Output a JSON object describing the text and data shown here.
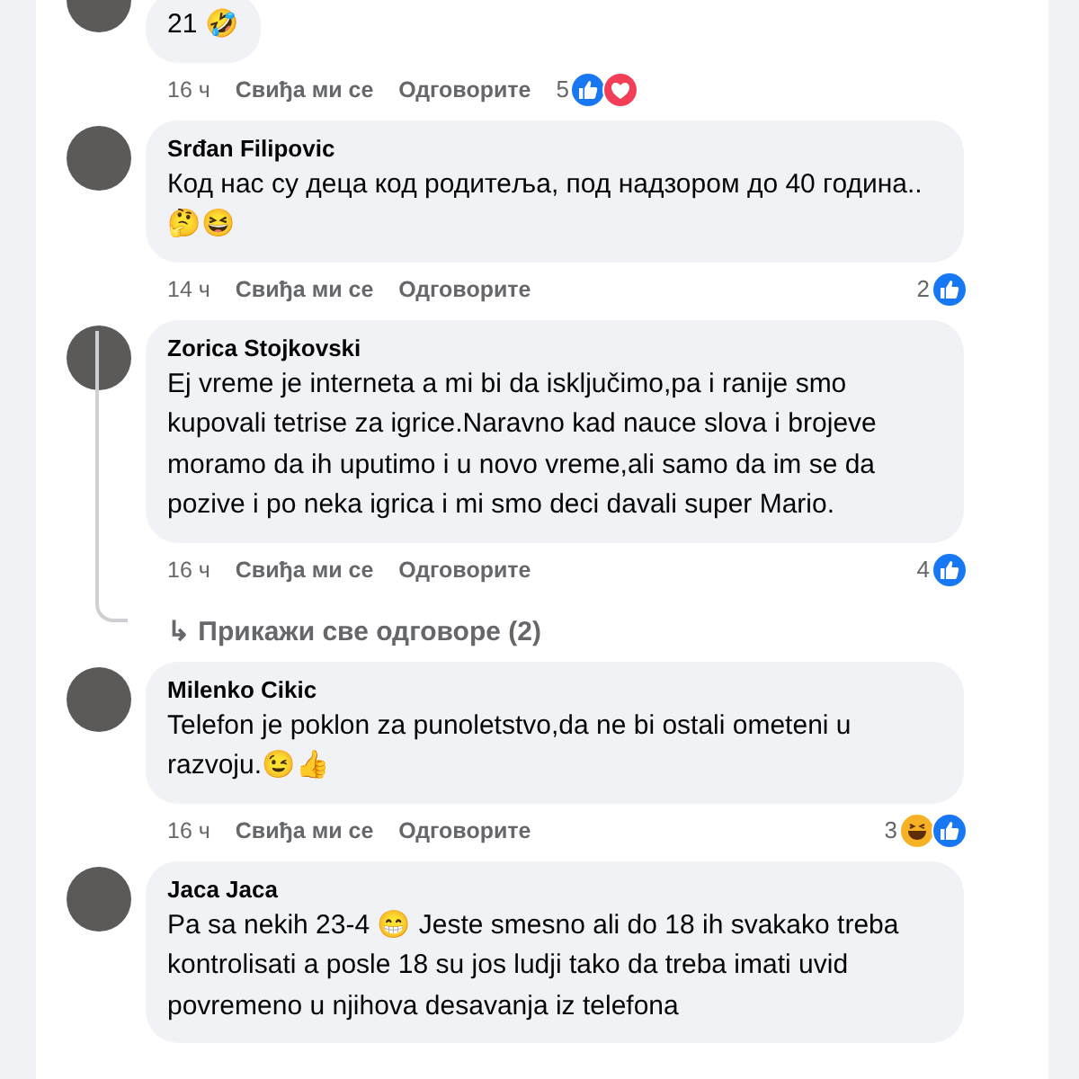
{
  "comments": [
    {
      "text": "21 🤣",
      "time": "16 ч",
      "like_label": "Свиђа ми се",
      "reply_label": "Одговорите",
      "reaction_count": "5",
      "reactions": [
        {
          "kind": "like"
        },
        {
          "kind": "love"
        }
      ]
    },
    {
      "author": "Srđan Filipovic",
      "text": "Код нас су деца код родитеља, под надзором до 40 година..🤔😆",
      "time": "14 ч",
      "like_label": "Свиђа ми се",
      "reply_label": "Одговорите",
      "reaction_count": "2",
      "reactions": [
        {
          "kind": "like"
        }
      ]
    },
    {
      "author": "Zorica Stojkovski",
      "text": "Ej vreme je interneta a mi bi da isključimo,pa i ranije smo kupovali tetrise za igrice.Naravno kad nauce slova i brojeve moramo da ih uputimo i u novo vreme,ali samo da im se da pozive i po neka igrica i mi smo deci davali super Mario.",
      "time": "16 ч",
      "like_label": "Свиђа ми се",
      "reply_label": "Одговорите",
      "reaction_count": "4",
      "reactions": [
        {
          "kind": "like"
        }
      ],
      "replies_link": {
        "arrow": "↳",
        "label": "Прикажи све одговоре (2)"
      }
    },
    {
      "author": "Milenko Cikic",
      "text": "Telefon je poklon za punoletstvo,da ne bi ostali ometeni u razvoju.😉👍",
      "time": "16 ч",
      "like_label": "Свиђа ми се",
      "reply_label": "Одговорите",
      "reaction_count": "3",
      "reactions": [
        {
          "kind": "haha"
        },
        {
          "kind": "like"
        }
      ]
    },
    {
      "author": "Jaca Jaca",
      "text": "Pa sa nekih 23-4 😁 Jeste smesno ali do 18 ih svakako treba kontrolisati a posle 18 su jos ludji tako da treba imati uvid povremeno u njihova desavanja iz telefona"
    }
  ]
}
